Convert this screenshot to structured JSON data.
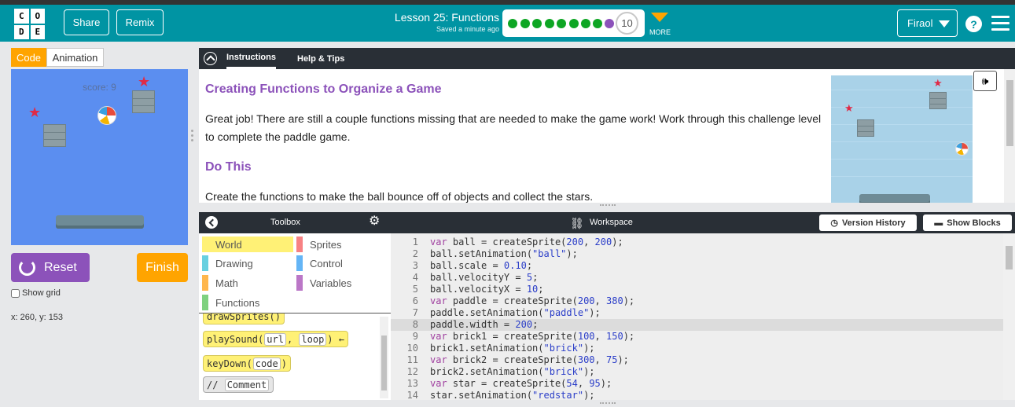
{
  "header": {
    "logo_letters": [
      "C",
      "O",
      "D",
      "E"
    ],
    "share_label": "Share",
    "remix_label": "Remix",
    "lesson_title": "Lesson 25: Functions",
    "saved_text": "Saved a minute ago",
    "progress": {
      "completed": 8,
      "current_purple": 1,
      "level_number": "10"
    },
    "more_label": "MORE",
    "user_name": "Firaol",
    "help_label": "?",
    "accent_color": "#0094a3"
  },
  "left_panel": {
    "code_toggle": "Code",
    "animation_toggle": "Animation",
    "score_text": "score: 9",
    "reset_label": "Reset",
    "finish_label": "Finish",
    "show_grid_label": "Show grid",
    "coords_text": "x: 260, y: 153"
  },
  "instructions": {
    "tab_instructions": "Instructions",
    "tab_help": "Help & Tips",
    "heading1": "Creating Functions to Organize a Game",
    "paragraph1": "Great job! There are still a couple functions missing that are needed to make the game work! Work through this challenge level to complete the paddle game.",
    "heading2": "Do This",
    "paragraph2": "Create the functions to make the ball bounce off of objects and collect the stars."
  },
  "toolbox": {
    "title": "Toolbox",
    "categories": [
      {
        "label": "World",
        "color": "#fff176",
        "selected": true
      },
      {
        "label": "Sprites",
        "color": "#f78183"
      },
      {
        "label": "Drawing",
        "color": "#68d0e0"
      },
      {
        "label": "Control",
        "color": "#64b5f6"
      },
      {
        "label": "Math",
        "color": "#ffb74d"
      },
      {
        "label": "Variables",
        "color": "#bb77c7"
      },
      {
        "label": "Functions",
        "color": "#7fd17f"
      }
    ],
    "blocks": {
      "draw_sprites": "drawSprites()",
      "play_sound_name": "playSound(",
      "play_sound_p1": "url",
      "play_sound_p2": "loop",
      "play_sound_end": ") ←",
      "key_down_name": "keyDown(",
      "key_down_p1": "code",
      "key_down_end": ")",
      "comment_prefix": "//",
      "comment_text": "Comment"
    }
  },
  "workspace": {
    "title": "Workspace",
    "version_history_label": "Version History",
    "show_blocks_label": "Show Blocks",
    "highlighted_line": 8,
    "lines": [
      "var ball = createSprite(200, 200);",
      "ball.setAnimation(\"ball\");",
      "ball.scale = 0.10;",
      "ball.velocityY = 5;",
      "ball.velocityX = 10;",
      "var paddle = createSprite(200, 380);",
      "paddle.setAnimation(\"paddle\");",
      "paddle.width = 200;",
      "var brick1 = createSprite(100, 150);",
      "brick1.setAnimation(\"brick\");",
      "var brick2 = createSprite(300, 75);",
      "brick2.setAnimation(\"brick\");",
      "var star = createSprite(54, 95);",
      "star.setAnimation(\"redstar\");"
    ]
  }
}
